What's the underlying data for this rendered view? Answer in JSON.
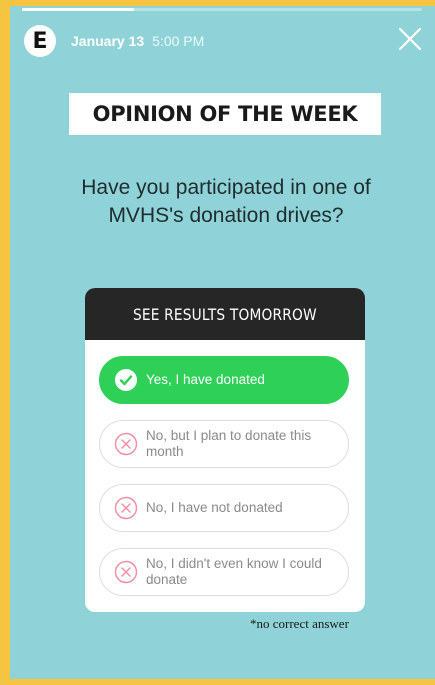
{
  "story": {
    "progress": 0.28,
    "account_avatar_letter": "E",
    "date": "January 13",
    "time": "5:00 PM"
  },
  "content": {
    "title": "OPINION OF THE WEEK",
    "question": "Have you participated in one of MVHS's donation drives?",
    "footnote": "*no correct answer"
  },
  "poll": {
    "header": "SEE RESULTS TOMORROW",
    "options": [
      {
        "label": "Yes, I have donated",
        "selected": true
      },
      {
        "label": "No, but I plan to donate this month",
        "selected": false
      },
      {
        "label": "No, I have not donated",
        "selected": false
      },
      {
        "label": "No, I didn't even know I could donate",
        "selected": false
      }
    ]
  },
  "colors": {
    "background": "#8fd3d8",
    "frame": "#f5c542",
    "selected": "#2ed058",
    "wrong": "#f08fa3"
  },
  "icons": {
    "close": "close-icon",
    "check": "checkmark-icon",
    "wrong": "x-circle-icon"
  }
}
